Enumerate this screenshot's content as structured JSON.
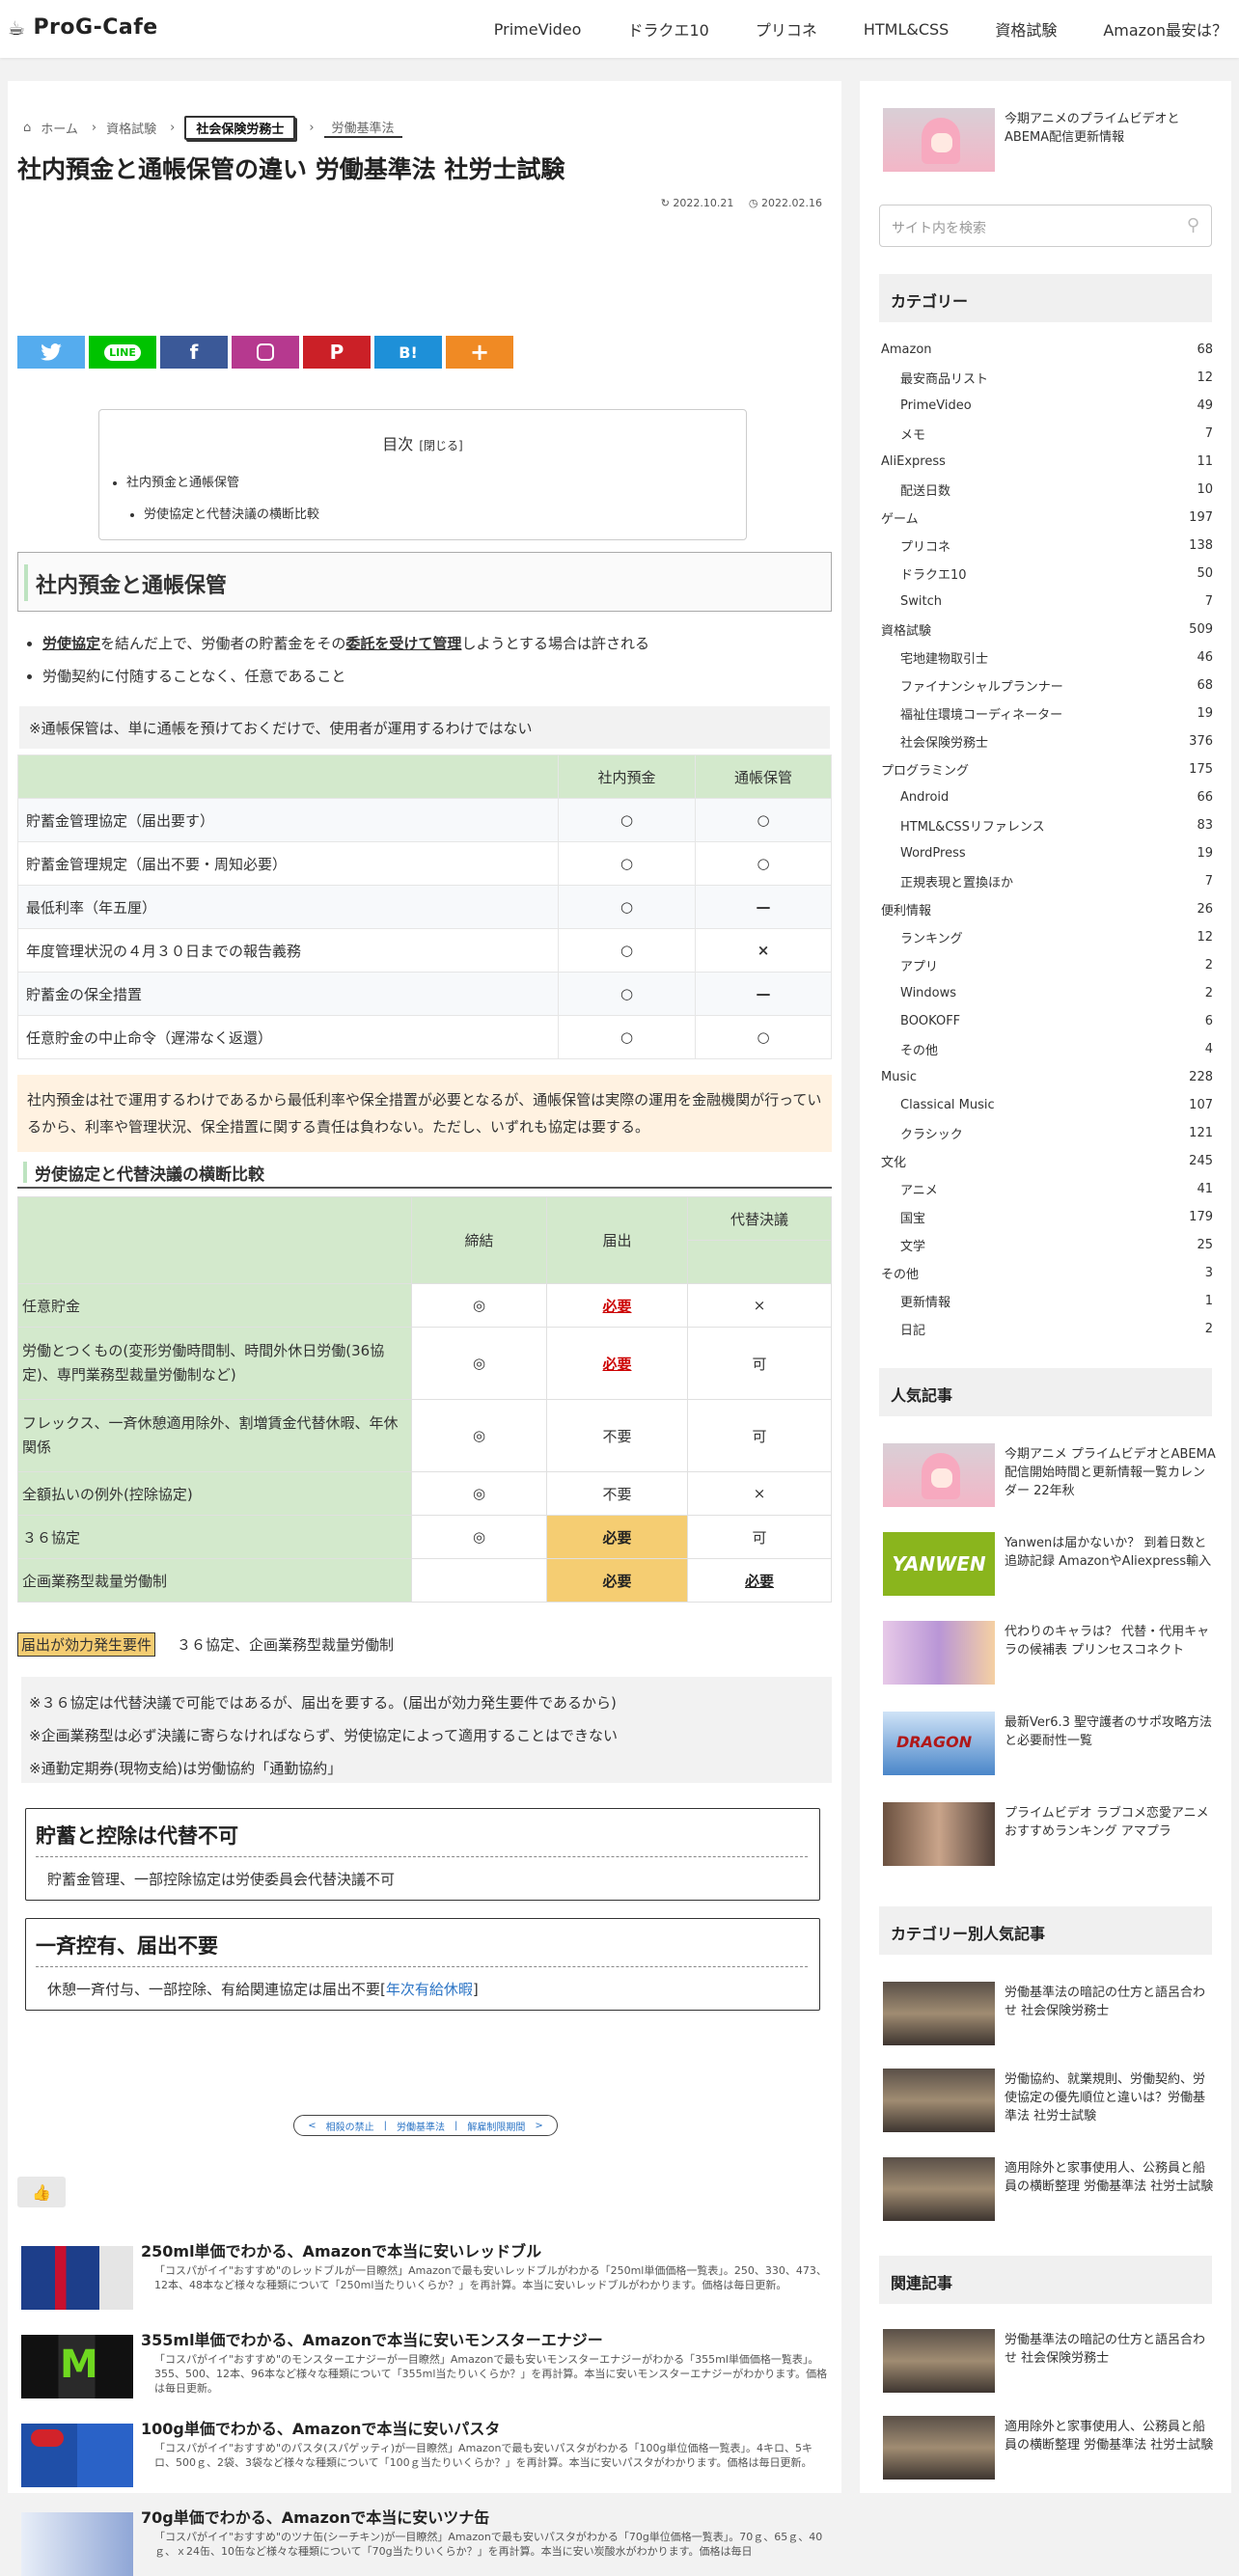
{
  "header": {
    "logo": "ProG-Cafe",
    "nav": [
      "PrimeVideo",
      "ドラクエ10",
      "プリコネ",
      "HTML&CSS",
      "資格試験",
      "Amazon最安は？"
    ]
  },
  "breadcrumb": {
    "home": "ホーム",
    "items": [
      "資格試験",
      "社会保険労務士",
      "労働基準法"
    ]
  },
  "article": {
    "title": "社内預金と通帳保管の違い 労働基準法 社労士試験",
    "updated": "2022.10.21",
    "published": "2022.02.16",
    "toc": {
      "title": "目次",
      "toggle": "[閉じる]",
      "items": [
        "社内預金と通帳保管",
        "労使協定と代替決議の横断比較"
      ]
    },
    "h2": "社内預金と通帳保管",
    "bullets": [
      {
        "pre": "",
        "u1": "労使協定",
        "mid": "を結んだ上で、労働者の貯蓄金をその",
        "u2": "委託を受けて管理",
        "post": "しようとする場合は許される"
      },
      {
        "text": "労働契約に付随することなく、任意であること"
      }
    ],
    "note1": "※通帳保管は、単に通帳を預けておくだけで、使用者が運用するわけではない",
    "table1": {
      "headers": [
        "",
        "社内預金",
        "通帳保管"
      ],
      "rows": [
        {
          "label": "貯蓄金管理協定（届出要す）",
          "a": "○",
          "b": "○"
        },
        {
          "label": "貯蓄金管理規定（届出不要・周知必要）",
          "a": "○",
          "b": "○"
        },
        {
          "label": "最低利率（年五厘）",
          "a": "○",
          "b": "—"
        },
        {
          "label": "年度管理状況の４月３０日までの報告義務",
          "a": "○",
          "b": "×"
        },
        {
          "label": "貯蓄金の保全措置",
          "a": "○",
          "b": "—"
        },
        {
          "label": "任意貯金の中止命令（遅滞なく返還）",
          "a": "○",
          "b": "○"
        }
      ]
    },
    "orange": "社内預金は社で運用するわけであるから最低利率や保全措置が必要となるが、通帳保管は実際の運用を金融機関が行っているから、利率や管理状況、保全措置に関する責任は負わない。ただし、いずれも協定は要する。",
    "h3": "労使協定と代替決議の横断比較",
    "table2": {
      "headers": [
        "",
        "締結",
        "届出",
        "代替決議"
      ],
      "rows": [
        {
          "label": "任意貯金",
          "a": "◎",
          "b": "必要",
          "c": "×"
        },
        {
          "label": "労働とつくもの(変形労働時間制、時間外休日労働(36協定)、専門業務型裁量労働制など)",
          "a": "◎",
          "b": "必要",
          "c": "可"
        },
        {
          "label": "フレックス、一斉休憩適用除外、割増賃金代替休暇、年休関係",
          "a": "◎",
          "b": "不要",
          "c": "可"
        },
        {
          "label": "全額払いの例外(控除協定)",
          "a": "◎",
          "b": "不要",
          "c": "×"
        },
        {
          "label": "３６協定",
          "a": "◎",
          "b": "必要",
          "c": "可"
        },
        {
          "label": "企画業務型裁量労働制",
          "a": "",
          "b": "必要",
          "c": "必要"
        }
      ]
    },
    "eff": {
      "tag": "届出が効力発生要件",
      "text": "３６協定、企画業務型裁量労働制"
    },
    "note2": [
      "※３６協定は代替決議で可能ではあるが、届出を要する。(届出が効力発生要件であるから)",
      "※企画業務型は必ず決議に寄らなければならず、労使協定によって適用することはできない",
      "※通勤定期券(現物支給)は労働協約「通勤協約」"
    ],
    "box1": {
      "title": "貯蓄と控除は代替不可",
      "body": "貯蓄金管理、一部控除協定は労使委員会代替決議不可"
    },
    "box2": {
      "title": "一斉控有、届出不要",
      "body": "休憩一斉付与、一部控除、有給関連協定は届出不要[",
      "link": "年次有給休暇",
      "end": "]"
    },
    "pager": [
      "<",
      "相殺の禁止",
      "|",
      "労働基準法",
      "|",
      "解雇制限期間",
      ">"
    ],
    "related": [
      {
        "title": "250ml単価でわかる、Amazonで本当に安いレッドブル",
        "desc": "「コスパがイイ\"おすすめ\"のレッドブルが一目瞭然」Amazonで最も安いレッドブルがわかる「250ml単価価格一覧表」。250、330、473、12本、48本など様々な種類について「250ml当たりいくらか？」を再計算。本当に安いレッドブルがわかります。価格は毎日更新。"
      },
      {
        "title": "355ml単価でわかる、Amazonで本当に安いモンスターエナジー",
        "desc": "「コスパがイイ\"おすすめ\"のモンスターエナジーが一目瞭然」Amazonで最も安いモンスターエナジーがわかる「355ml単価価格一覧表」。355、500、12本、96本など様々な種類について「355ml当たりいくらか？」を再計算。本当に安いモンスターエナジーがわかります。価格は毎日更新。"
      },
      {
        "title": "100g単価でわかる、Amazonで本当に安いパスタ",
        "desc": "「コスパがイイ\"おすすめ\"のパスタ(スパゲッティ)が一目瞭然」Amazonで最も安いパスタがわかる「100g単位価格一覧表」。4キロ、5キロ、500ｇ、2袋、3袋など様々な種類について「100ｇ当たりいくらか？」を再計算。本当に安いパスタがわかります。価格は毎日更新。"
      },
      {
        "title": "70g単価でわかる、Amazonで本当に安いツナ缶",
        "desc": "「コスパがイイ\"おすすめ\"のツナ缶(シーチキン)が一目瞭然」Amazonで最も安いパスタがわかる「70g単位価格一覧表」。70ｇ、65ｇ、40ｇ、ｘ24缶、10缶など様々な種類について「70g当たりいくらか？」を再計算。本当に安い炭酸水がわかります。価格は毎日"
      }
    ]
  },
  "sidebar": {
    "top_post": "今期アニメのプライムビデオとABEMA配信更新情報",
    "search_placeholder": "サイト内を検索",
    "categories_title": "カテゴリー",
    "categories": [
      {
        "name": "Amazon",
        "count": "68",
        "sub": false
      },
      {
        "name": "最安商品リスト",
        "count": "12",
        "sub": true
      },
      {
        "name": "PrimeVideo",
        "count": "49",
        "sub": true
      },
      {
        "name": "メモ",
        "count": "7",
        "sub": true
      },
      {
        "name": "AliExpress",
        "count": "11",
        "sub": false
      },
      {
        "name": "配送日数",
        "count": "10",
        "sub": true
      },
      {
        "name": "ゲーム",
        "count": "197",
        "sub": false
      },
      {
        "name": "プリコネ",
        "count": "138",
        "sub": true
      },
      {
        "name": "ドラクエ10",
        "count": "50",
        "sub": true
      },
      {
        "name": "Switch",
        "count": "7",
        "sub": true
      },
      {
        "name": "資格試験",
        "count": "509",
        "sub": false
      },
      {
        "name": "宅地建物取引士",
        "count": "46",
        "sub": true
      },
      {
        "name": "ファイナンシャルプランナー",
        "count": "68",
        "sub": true
      },
      {
        "name": "福祉住環境コーディネーター",
        "count": "19",
        "sub": true
      },
      {
        "name": "社会保険労務士",
        "count": "376",
        "sub": true
      },
      {
        "name": "プログラミング",
        "count": "175",
        "sub": false
      },
      {
        "name": "Android",
        "count": "66",
        "sub": true
      },
      {
        "name": "HTML&CSSリファレンス",
        "count": "83",
        "sub": true
      },
      {
        "name": "WordPress",
        "count": "19",
        "sub": true
      },
      {
        "name": "正規表現と置換ほか",
        "count": "7",
        "sub": true
      },
      {
        "name": "便利情報",
        "count": "26",
        "sub": false
      },
      {
        "name": "ランキング",
        "count": "12",
        "sub": true
      },
      {
        "name": "アプリ",
        "count": "2",
        "sub": true
      },
      {
        "name": "Windows",
        "count": "2",
        "sub": true
      },
      {
        "name": "BOOKOFF",
        "count": "6",
        "sub": true
      },
      {
        "name": "その他",
        "count": "4",
        "sub": true
      },
      {
        "name": "Music",
        "count": "228",
        "sub": false
      },
      {
        "name": "Classical Music",
        "count": "107",
        "sub": true
      },
      {
        "name": "クラシック",
        "count": "121",
        "sub": true
      },
      {
        "name": "文化",
        "count": "245",
        "sub": false
      },
      {
        "name": "アニメ",
        "count": "41",
        "sub": true
      },
      {
        "name": "国宝",
        "count": "179",
        "sub": true
      },
      {
        "name": "文学",
        "count": "25",
        "sub": true
      },
      {
        "name": "その他",
        "count": "3",
        "sub": false
      },
      {
        "name": "更新情報",
        "count": "1",
        "sub": true
      },
      {
        "name": "日記",
        "count": "2",
        "sub": true
      }
    ],
    "popular_title": "人気記事",
    "popular": [
      "今期アニメ プライムビデオとABEMA配信開始時間と更新情報一覧カレンダー 22年秋",
      "Yanwenは届かないか？ 到着日数と追跡記録 AmazonやAliexpress輸入",
      "代わりのキャラは？ 代替・代用キャラの候補表 プリンセスコネクト",
      "最新Ver6.3 聖守護者のサポ攻略方法と必要耐性一覧",
      "プライムビデオ ラブコメ恋愛アニメおすすめランキング アマプラ"
    ],
    "catpop_title": "カテゴリー別人気記事",
    "catpop": [
      "労働基準法の暗記の仕方と語呂合わせ 社会保険労務士",
      "労働協約、就業規則、労働契約、労使協定の優先順位と違いは？労働基準法 社労士試験",
      "適用除外と家事使用人、公務員と船員の横断整理 労働基準法 社労士試験"
    ],
    "related_title": "関連記事",
    "related": [
      "労働基準法の暗記の仕方と語呂合わせ 社会保険労務士",
      "適用除外と家事使用人、公務員と船員の横断整理 労働基準法 社労士試験"
    ],
    "yanwen_logo": "YANWEN"
  }
}
